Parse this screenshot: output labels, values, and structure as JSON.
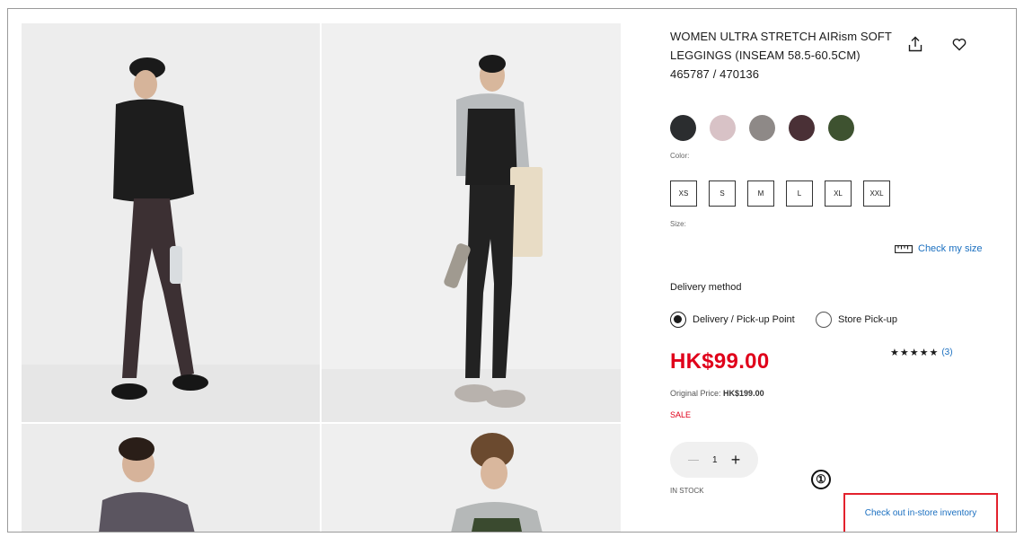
{
  "product": {
    "title": "WOMEN ULTRA STRETCH AIRism SOFT LEGGINGS (INSEAM 58.5-60.5CM) 465787 / 470136",
    "share_icon": "share-icon",
    "favorite_icon": "heart-icon"
  },
  "gallery": {
    "images": [
      {
        "name": "model-black-jacket-brown-leggings"
      },
      {
        "name": "model-grey-sweater-black-leggings"
      },
      {
        "name": "model-grey-fleece"
      },
      {
        "name": "model-grey-hoodie"
      }
    ]
  },
  "colors": {
    "label": "Color:",
    "swatches": [
      {
        "name": "black",
        "hex": "#2b2d2f"
      },
      {
        "name": "pink",
        "hex": "#d8c2c6"
      },
      {
        "name": "grey",
        "hex": "#8e8987"
      },
      {
        "name": "dark-brown",
        "hex": "#4a3036"
      },
      {
        "name": "olive",
        "hex": "#3e5230"
      }
    ]
  },
  "sizes": {
    "label": "Size:",
    "options": [
      "XS",
      "S",
      "M",
      "L",
      "XL",
      "XXL"
    ]
  },
  "check_size": {
    "label": "Check my size",
    "icon": "ruler-icon"
  },
  "delivery": {
    "heading": "Delivery method",
    "options": [
      {
        "label": "Delivery / Pick-up Point",
        "selected": true
      },
      {
        "label": "Store Pick-up",
        "selected": false
      }
    ]
  },
  "pricing": {
    "price": "HK$99.00",
    "original_label": "Original Price:",
    "original_value": "HK$199.00",
    "sale_label": "SALE"
  },
  "rating": {
    "stars": "★★★★★",
    "reviews": "(3)",
    "value": 5
  },
  "quantity": {
    "value": "1",
    "plus": "+"
  },
  "stock": "IN STOCK",
  "annotation": {
    "marker": "①"
  },
  "inventory_button": "Check out in-store inventory",
  "theme": {
    "accent_red": "#e0001a",
    "link_blue": "#1a6fc0",
    "highlight_border": "#e3212d"
  }
}
